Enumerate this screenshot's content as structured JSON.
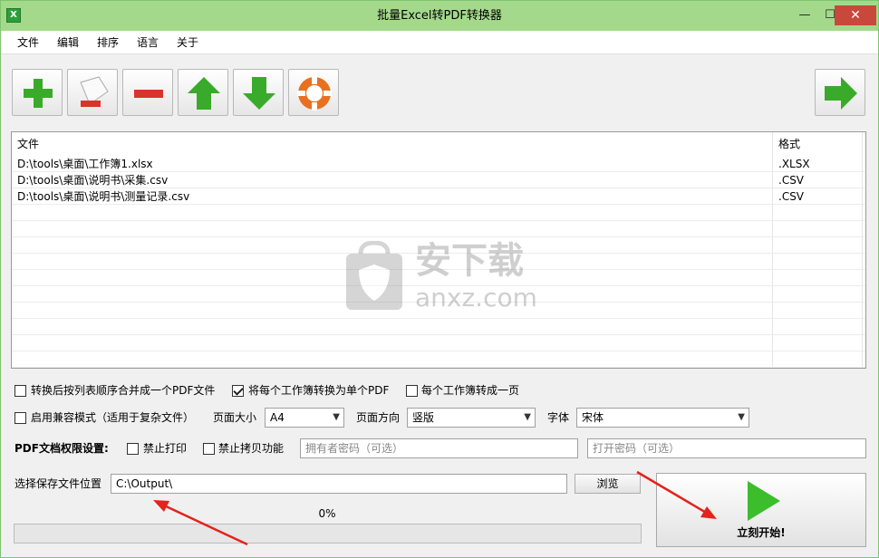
{
  "window": {
    "title": "批量Excel转PDF转换器",
    "controls": {
      "minimize": "—",
      "maximize": "☐",
      "close": "✕"
    }
  },
  "menu": [
    "文件",
    "编辑",
    "排序",
    "语言",
    "关于"
  ],
  "toolbar": {
    "buttons": [
      {
        "name": "add-file-button",
        "icon": "plus-icon"
      },
      {
        "name": "remove-file-button",
        "icon": "remove-page-icon"
      },
      {
        "name": "clear-list-button",
        "icon": "minus-icon"
      },
      {
        "name": "move-up-button",
        "icon": "arrow-up-icon"
      },
      {
        "name": "move-down-button",
        "icon": "arrow-down-icon"
      },
      {
        "name": "help-button",
        "icon": "lifebuoy-icon"
      },
      {
        "name": "next-button",
        "icon": "arrow-right-icon"
      }
    ],
    "colors": {
      "green": "#3aaa2a",
      "red": "#d9342b",
      "orange": "#e8701e"
    }
  },
  "filelist": {
    "columns": [
      "文件",
      "格式"
    ],
    "rows": [
      {
        "file": "D:\\tools\\桌面\\工作簿1.xlsx",
        "format": ".XLSX"
      },
      {
        "file": "D:\\tools\\桌面\\说明书\\采集.csv",
        "format": ".CSV"
      },
      {
        "file": "D:\\tools\\桌面\\说明书\\测量记录.csv",
        "format": ".CSV"
      }
    ],
    "watermark": {
      "cn": "安下载",
      "en": "anxz.com"
    }
  },
  "options": {
    "merge_label": "转换后按列表顺序合并成一个PDF文件",
    "merge_checked": false,
    "per_workbook_label": "将每个工作簿转换为单个PDF",
    "per_workbook_checked": true,
    "one_page_label": "每个工作簿转成一页",
    "one_page_checked": false,
    "compat_label": "启用兼容模式（适用于复杂文件）",
    "compat_checked": false,
    "page_size_label": "页面大小",
    "page_size_value": "A4",
    "orientation_label": "页面方向",
    "orientation_value": "竖版",
    "font_label": "字体",
    "font_value": "宋体"
  },
  "permissions": {
    "title": "PDF文档权限设置:",
    "no_print_label": "禁止打印",
    "no_copy_label": "禁止拷贝功能",
    "owner_pw_placeholder": "拥有者密码（可选）",
    "open_pw_placeholder": "打开密码（可选）"
  },
  "output": {
    "label": "选择保存文件位置",
    "path": "C:\\Output\\",
    "browse_label": "浏览"
  },
  "progress": {
    "percent_text": "0%",
    "value": 0
  },
  "start": {
    "label": "立刻开始!"
  }
}
